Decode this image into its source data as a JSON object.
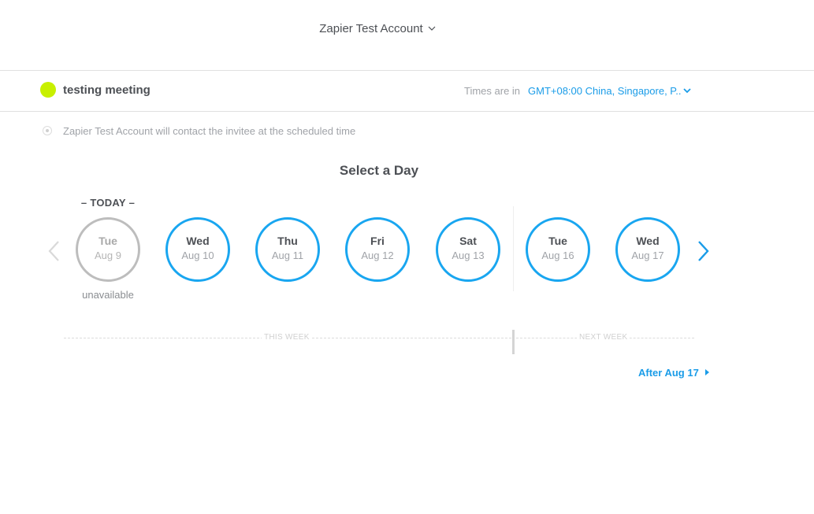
{
  "header": {
    "account_name": "Zapier Test Account"
  },
  "event": {
    "name": "testing meeting",
    "dot_color": "#c8f000"
  },
  "timezone": {
    "label": "Times are in",
    "value": "GMT+08:00 China, Singapore, P.."
  },
  "contact": {
    "text": "Zapier Test Account will contact the invitee at the scheduled time"
  },
  "picker": {
    "title": "Select a Day",
    "today_label": "– TODAY –",
    "unavailable_label": "unavailable",
    "days": [
      {
        "dow": "Tue",
        "date": "Aug 9",
        "available": false
      },
      {
        "dow": "Wed",
        "date": "Aug 10",
        "available": true
      },
      {
        "dow": "Thu",
        "date": "Aug 11",
        "available": true
      },
      {
        "dow": "Fri",
        "date": "Aug 12",
        "available": true
      },
      {
        "dow": "Sat",
        "date": "Aug 13",
        "available": true
      },
      {
        "dow": "Tue",
        "date": "Aug 16",
        "available": true
      },
      {
        "dow": "Wed",
        "date": "Aug 17",
        "available": true
      }
    ],
    "this_week_label": "THIS WEEK",
    "next_week_label": "NEXT WEEK",
    "after_link": "After Aug 17"
  },
  "colors": {
    "accent": "#1a9ce8",
    "circle_available": "#19a6f0",
    "circle_unavailable": "#bdbdbd"
  }
}
